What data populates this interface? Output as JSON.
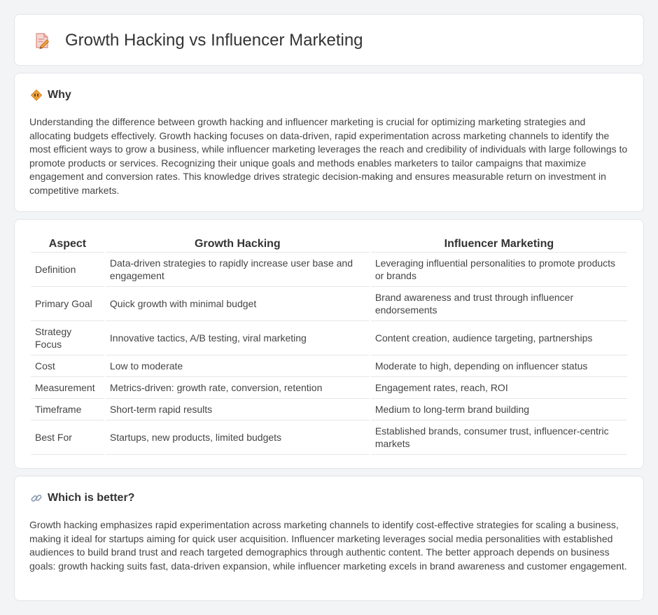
{
  "header": {
    "title": "Growth Hacking vs Influencer Marketing",
    "icon": "document-pencil-icon"
  },
  "why": {
    "title": "Why",
    "icon": "diamond-icon",
    "text": "Understanding the difference between growth hacking and influencer marketing is crucial for optimizing marketing strategies and allocating budgets effectively. Growth hacking focuses on data-driven, rapid experimentation across marketing channels to identify the most efficient ways to grow a business, while influencer marketing leverages the reach and credibility of individuals with large followings to promote products or services. Recognizing their unique goals and methods enables marketers to tailor campaigns that maximize engagement and conversion rates. This knowledge drives strategic decision-making and ensures measurable return on investment in competitive markets."
  },
  "table": {
    "headers": [
      "Aspect",
      "Growth Hacking",
      "Influencer Marketing"
    ],
    "rows": [
      [
        "Definition",
        "Data-driven strategies to rapidly increase user base and engagement",
        "Leveraging influential personalities to promote products or brands"
      ],
      [
        "Primary Goal",
        "Quick growth with minimal budget",
        "Brand awareness and trust through influencer endorsements"
      ],
      [
        "Strategy Focus",
        "Innovative tactics, A/B testing, viral marketing",
        "Content creation, audience targeting, partnerships"
      ],
      [
        "Cost",
        "Low to moderate",
        "Moderate to high, depending on influencer status"
      ],
      [
        "Measurement",
        "Metrics-driven: growth rate, conversion, retention",
        "Engagement rates, reach, ROI"
      ],
      [
        "Timeframe",
        "Short-term rapid results",
        "Medium to long-term brand building"
      ],
      [
        "Best For",
        "Startups, new products, limited budgets",
        "Established brands, consumer trust, influencer-centric markets"
      ]
    ]
  },
  "better": {
    "title": "Which is better?",
    "icon": "link-icon",
    "text": "Growth hacking emphasizes rapid experimentation across marketing channels to identify cost-effective strategies for scaling a business, making it ideal for startups aiming for quick user acquisition. Influencer marketing leverages social media personalities with established audiences to build brand trust and reach targeted demographics through authentic content. The better approach depends on business goals: growth hacking suits fast, data-driven expansion, while influencer marketing excels in brand awareness and customer engagement."
  },
  "colors": {
    "background": "#f3f4f6",
    "card": "#ffffff",
    "border": "#e3e5e8",
    "accent_orange": "#f0a13a",
    "icon_pink": "#e56b6f"
  }
}
